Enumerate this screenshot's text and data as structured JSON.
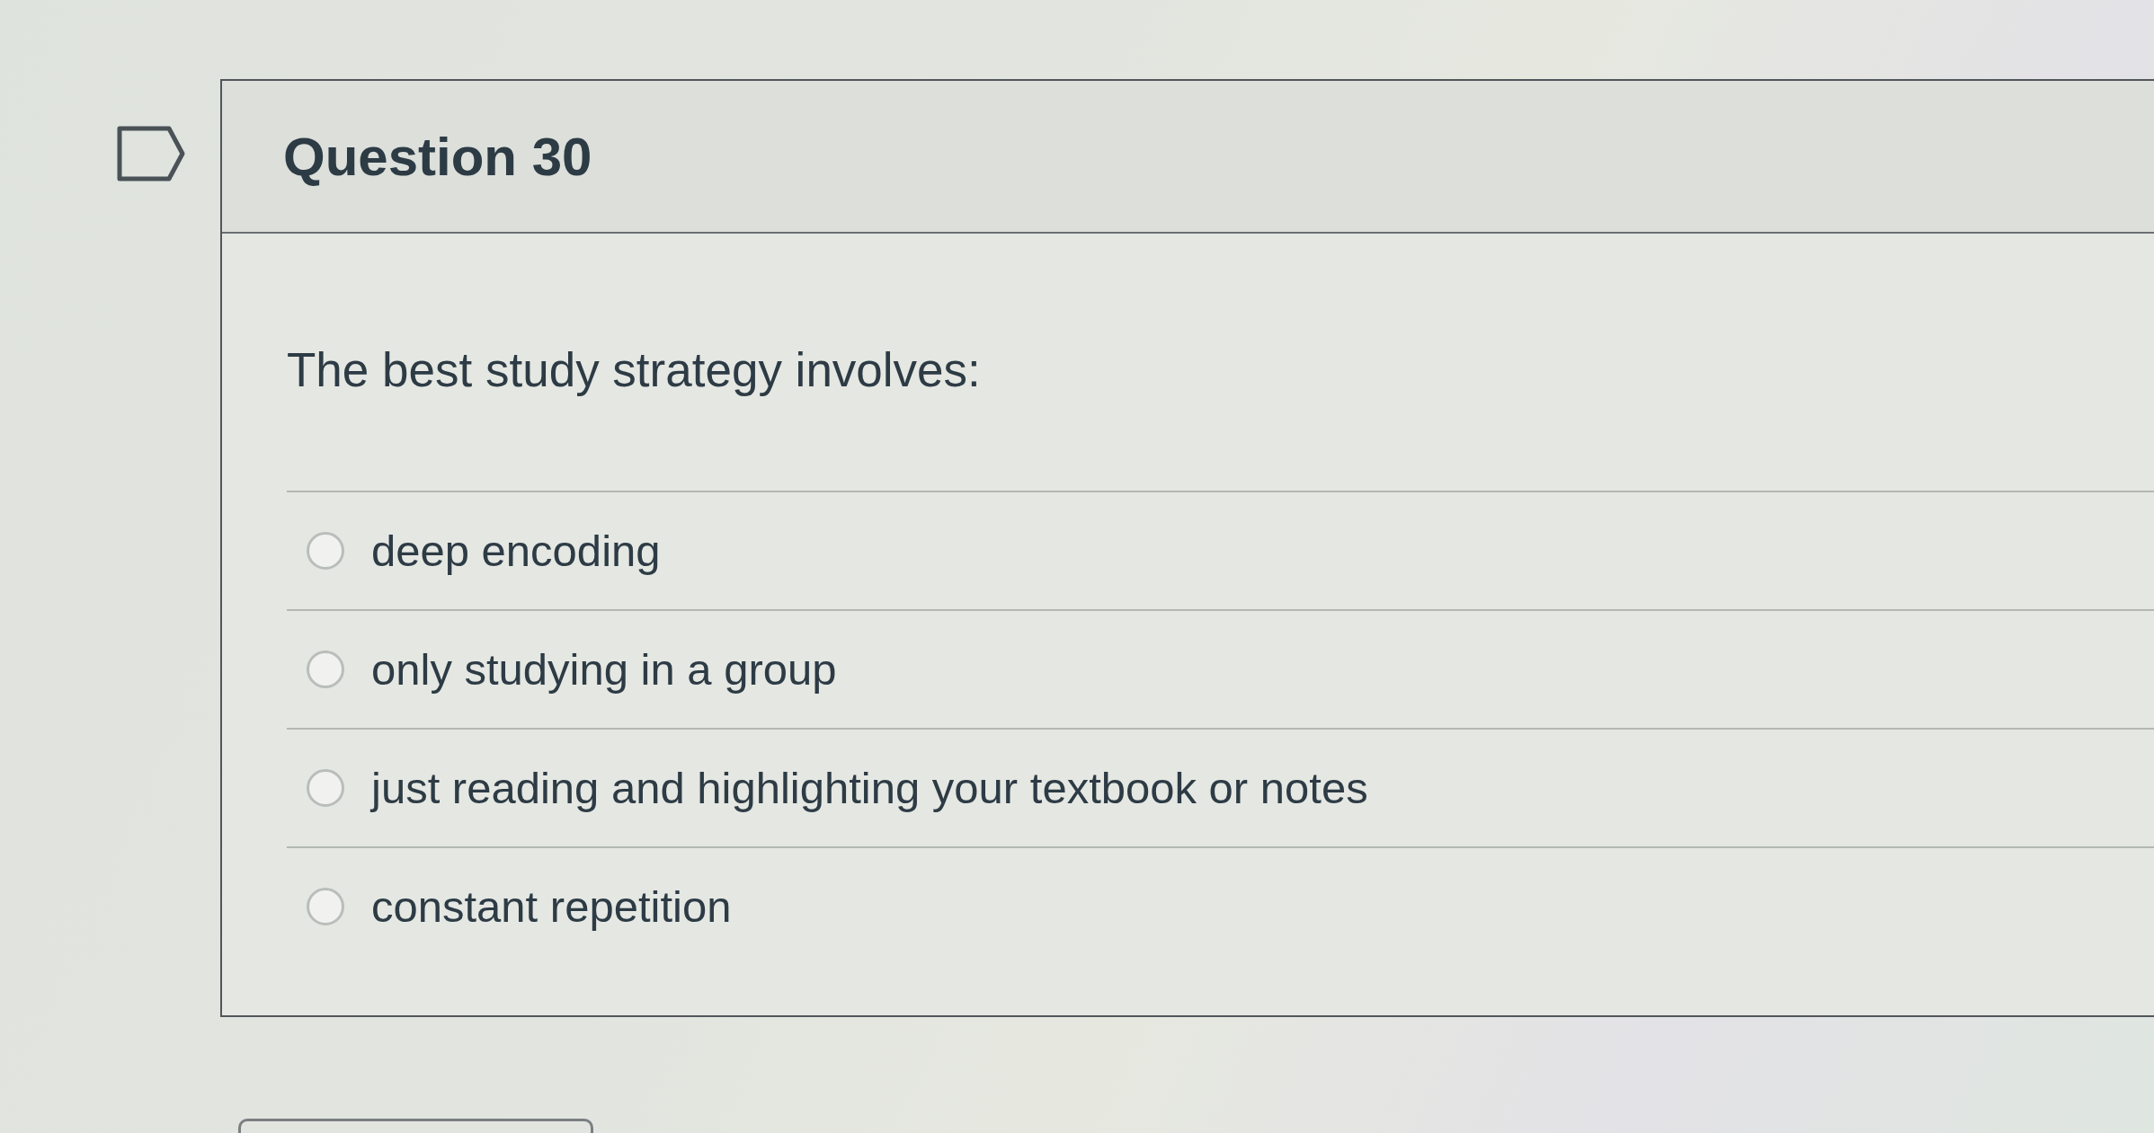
{
  "question": {
    "title": "Question 30",
    "flagged": false,
    "prompt": "The best study strategy involves:"
  },
  "answers": [
    {
      "label": "deep encoding",
      "selected": false
    },
    {
      "label": "only studying in a group",
      "selected": false
    },
    {
      "label": "just reading and highlighting your textbook or notes",
      "selected": false
    },
    {
      "label": "constant repetition",
      "selected": false
    }
  ]
}
